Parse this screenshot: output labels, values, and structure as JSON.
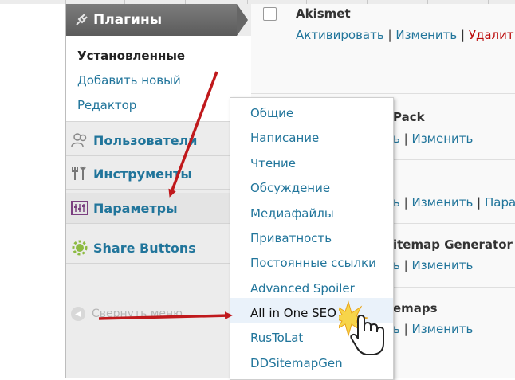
{
  "sidebar": {
    "plugins_header": "Плагины",
    "plugins_submenu": [
      "Установленные",
      "Добавить новый",
      "Редактор"
    ],
    "menu": [
      {
        "label": "Пользователи",
        "icon": "users-icon"
      },
      {
        "label": "Инструменты",
        "icon": "tools-icon"
      },
      {
        "label": "Параметры",
        "icon": "settings-icon"
      },
      {
        "label": "Share Buttons",
        "icon": "share-icon"
      }
    ],
    "collapse_label": "Свернуть меню"
  },
  "flyout": {
    "items": [
      "Общие",
      "Написание",
      "Чтение",
      "Обсуждение",
      "Медиафайлы",
      "Приватность",
      "Постоянные ссылки",
      "Advanced Spoiler",
      "All in One SEO",
      "RusToLat",
      "DDSitemapGen"
    ],
    "highlighted": "All in One SEO"
  },
  "plugins": {
    "akismet": {
      "name": "Akismet",
      "activate": "Активировать",
      "edit": "Изменить",
      "delete": "Удалит"
    },
    "row2": {
      "name_tail": "Pack",
      "frag": "ь",
      "edit": "Изменить"
    },
    "row3": {
      "frag": "ь",
      "edit": "Изменить",
      "cut": "Пара"
    },
    "row4": {
      "name_tail": "itemap Generator",
      "frag": "ь",
      "edit": "Изменить"
    },
    "row5": {
      "name_tail": "emaps",
      "frag": "ь",
      "edit": "Изменить"
    }
  },
  "separator": "|",
  "colors": {
    "link": "#21759b",
    "header_bg": "#666666",
    "delete": "#bc0b0b",
    "arrow": "#c0191c"
  }
}
